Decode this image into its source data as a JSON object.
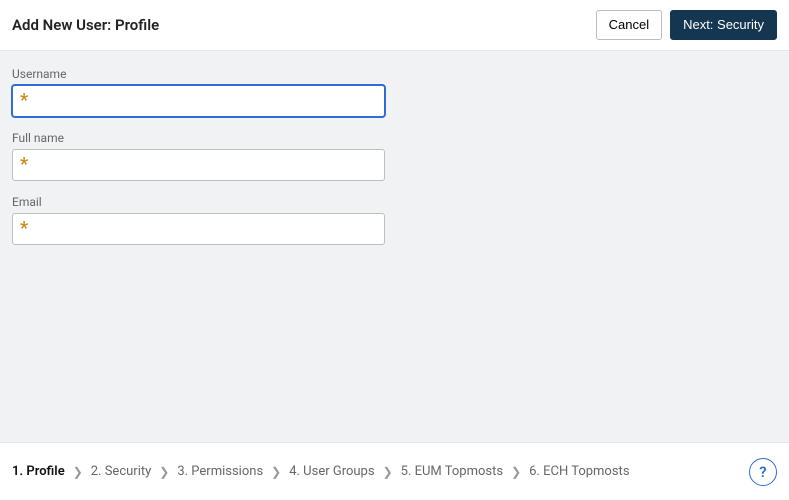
{
  "header": {
    "title": "Add New User: Profile",
    "cancel_label": "Cancel",
    "next_label": "Next: Security"
  },
  "fields": {
    "username": {
      "label": "Username",
      "value": "",
      "required": true
    },
    "fullname": {
      "label": "Full name",
      "value": "",
      "required": true
    },
    "email": {
      "label": "Email",
      "value": "",
      "required": true
    }
  },
  "required_marker": "*",
  "steps": [
    {
      "label": "1. Profile",
      "active": true
    },
    {
      "label": "2. Security",
      "active": false
    },
    {
      "label": "3. Permissions",
      "active": false
    },
    {
      "label": "4. User Groups",
      "active": false
    },
    {
      "label": "5. EUM Topmosts",
      "active": false
    },
    {
      "label": "6. ECH Topmosts",
      "active": false
    }
  ],
  "help_label": "?"
}
